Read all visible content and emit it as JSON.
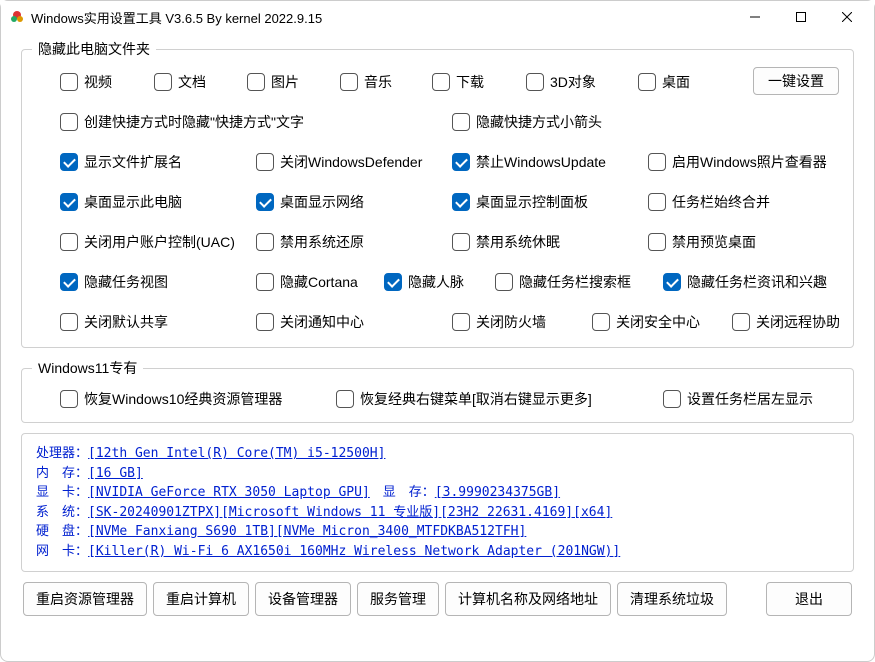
{
  "window": {
    "title": "Windows实用设置工具 V3.6.5 By kernel 2022.9.15"
  },
  "group1": {
    "legend": "隐藏此电脑文件夹",
    "folders": {
      "video": "视频",
      "documents": "文档",
      "pictures": "图片",
      "music": "音乐",
      "downloads": "下载",
      "objects3d": "3D对象",
      "desktop": "桌面"
    },
    "oneKeySet": "一键设置",
    "r2": {
      "hideShortcutText": "创建快捷方式时隐藏\"快捷方式\"文字",
      "hideShortcutArrow": "隐藏快捷方式小箭头"
    },
    "r3": {
      "showExt": "显示文件扩展名",
      "closeDefender": "关闭WindowsDefender",
      "disableUpdate": "禁止WindowsUpdate",
      "enablePhotoViewer": "启用Windows照片查看器"
    },
    "r4": {
      "desktopThisPC": "桌面显示此电脑",
      "desktopNetwork": "桌面显示网络",
      "desktopControlPanel": "桌面显示控制面板",
      "taskbarAlwaysCombine": "任务栏始终合并"
    },
    "r5": {
      "closeUAC": "关闭用户账户控制(UAC)",
      "disableSystemRestore": "禁用系统还原",
      "disableHibernate": "禁用系统休眠",
      "disablePreviewDesktop": "禁用预览桌面"
    },
    "r6": {
      "hideTaskView": "隐藏任务视图",
      "hideCortana": "隐藏Cortana",
      "hidePeople": "隐藏人脉",
      "hideTaskbarSearch": "隐藏任务栏搜索框",
      "hideTaskbarNewsInterests": "隐藏任务栏资讯和兴趣"
    },
    "r7": {
      "closeDefaultShare": "关闭默认共享",
      "closeNotificationCenter": "关闭通知中心",
      "closeFirewall": "关闭防火墙",
      "closeSecurityCenter": "关闭安全中心",
      "closeRemoteAssist": "关闭远程协助"
    }
  },
  "group2": {
    "legend": "Windows11专有",
    "restoreWin10Explorer": "恢复Windows10经典资源管理器",
    "restoreClassicContextMenu": "恢复经典右键菜单[取消右键显示更多]",
    "taskbarLeftAlign": "设置任务栏居左显示"
  },
  "info": {
    "l1a": "处理器：",
    "l1b": "[12th Gen Intel(R) Core(TM) i5-12500H]",
    "l2a": "内　存：",
    "l2b": "[16 GB]",
    "l3a": "显　卡：",
    "l3b": "[NVIDIA GeForce RTX 3050 Laptop GPU]",
    "l3c": "显　存：",
    "l3d": "[3.9990234375GB]",
    "l4a": "系　统：",
    "l4b": "[SK-20240901ZTPX][Microsoft Windows 11 专业版][23H2 22631.4169][x64]",
    "l5a": "硬　盘：",
    "l5b": "[NVMe Fanxiang S690 1TB][NVMe Micron_3400_MTFDKBA512TFH]",
    "l6a": "网　卡：",
    "l6b": "[Killer(R) Wi-Fi 6 AX1650i 160MHz Wireless Network Adapter (201NGW)]"
  },
  "buttons": {
    "restartExplorer": "重启资源管理器",
    "restartComputer": "重启计算机",
    "deviceManager": "设备管理器",
    "serviceManager": "服务管理",
    "computerNameNetwork": "计算机名称及网络地址",
    "cleanSystemJunk": "清理系统垃圾",
    "exit": "退出"
  }
}
